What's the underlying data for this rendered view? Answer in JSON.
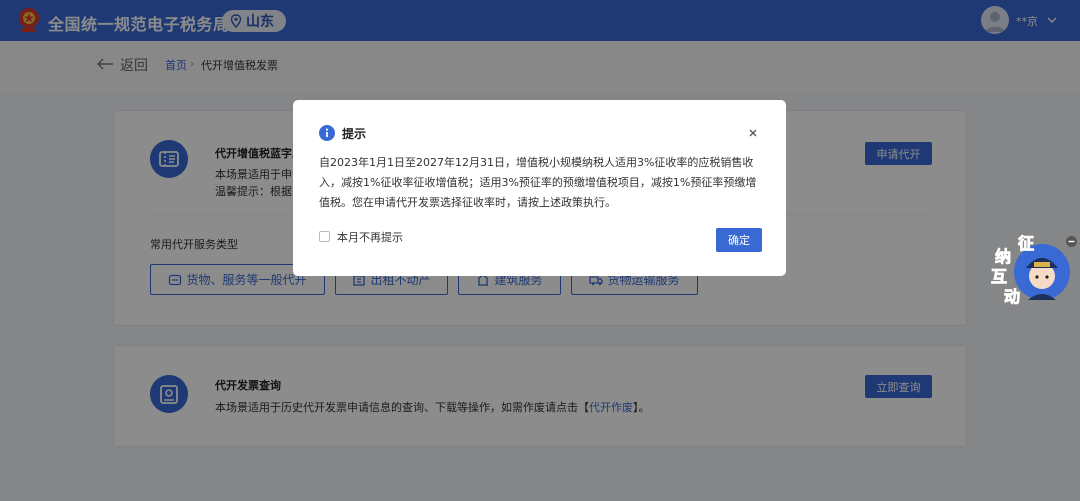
{
  "header": {
    "site_title": "全国统一规范电子税务局",
    "province": "山东",
    "user_name": "**京"
  },
  "nav": {
    "back_label": "返回",
    "breadcrumb_home": "首页",
    "breadcrumb_sep": "›",
    "breadcrumb_current": "代开增值税发票"
  },
  "card1": {
    "title": "代开增值税蓝字发",
    "desc_line1": "本场景适用于申请",
    "desc_line2": "温馨提示：根据目",
    "button": "申请代开",
    "types_label": "常用代开服务类型",
    "service_types": [
      "货物、服务等一般代开",
      "出租不动产",
      "建筑服务",
      "货物运输服务"
    ]
  },
  "card2": {
    "title": "代开发票查询",
    "desc_prefix": "本场景适用于历史代开发票申请信息的查询、下载等操作，如需作废请点击【",
    "desc_link": "代开作废",
    "desc_suffix": "】。",
    "button": "立即查询"
  },
  "dialog": {
    "title": "提示",
    "body": "自2023年1月1日至2027年12月31日，增值税小规模纳税人适用3%征收率的应税销售收入，减按1%征收率征收增值税；适用3%预征率的预缴增值税项目，减按1%预征率预缴增值税。您在申请代开发票选择征收率时，请按上述政策执行。",
    "checkbox_label": "本月不再提示",
    "confirm": "确定",
    "close_symbol": "×"
  },
  "mascot": {
    "text": [
      "征",
      "纳",
      "互",
      "动"
    ]
  },
  "colors": {
    "brand_blue": "#3869d4",
    "overlay": "rgba(0,0,0,0.45)"
  }
}
